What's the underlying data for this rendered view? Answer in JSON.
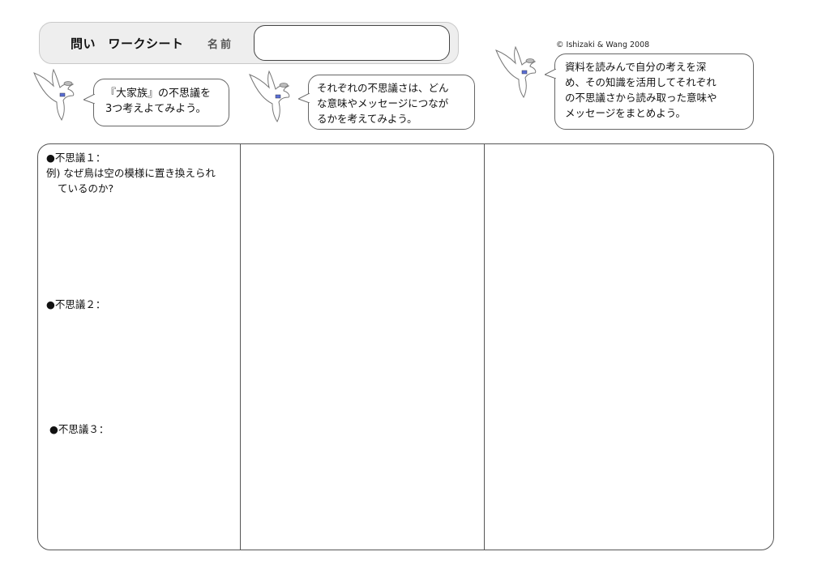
{
  "header": {
    "title": "問い　ワークシート",
    "name_label": "名前"
  },
  "copyright": "© Ishizaki & Wang 2008",
  "bubbles": {
    "step1": [
      "『大家族』の不思議を",
      "3つ考えよてみよう。"
    ],
    "step2": [
      "それぞれの不思議さは、どん",
      "な意味やメッセージにつなが",
      "るかを考えてみよう。"
    ],
    "step3": [
      "資料を読みんで自分の考えを深",
      "め、その知識を活用してそれぞれ",
      "の不思議さから読み取った意味や",
      "メッセージをまとめよう。"
    ]
  },
  "worksheet": {
    "mystery1_label": "●不思議１：",
    "mystery1_example_line1": "例) なぜ鳥は空の模様に置き換えられ",
    "mystery1_example_line2": "ているのか?",
    "mystery2_label": "●不思議２：",
    "mystery3_label": "●不思議３："
  },
  "icons": {
    "mascot": "dove-with-hat-icon"
  }
}
